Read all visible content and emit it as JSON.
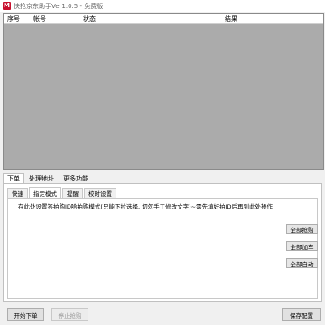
{
  "window": {
    "icon_letter": "M",
    "title": "快抢京东助手Ver1.0.5 - 免费版"
  },
  "table": {
    "columns": [
      "序号",
      "帐号",
      "状态",
      "结果"
    ]
  },
  "main_tabs": [
    {
      "label": "下单",
      "active": true
    },
    {
      "label": "处理地址",
      "active": false
    },
    {
      "label": "更多功能",
      "active": false
    }
  ],
  "sub_tabs": [
    {
      "label": "快速",
      "active": false
    },
    {
      "label": "指定模式",
      "active": true
    },
    {
      "label": "提醒",
      "active": false
    },
    {
      "label": "校时设置",
      "active": false
    }
  ],
  "panel": {
    "description": "在此处设置答拍购ID哈拍购模式(只能下拉选择, 切勿手工修改文字)~需先填好拍ID后再到此处操作",
    "buttons": {
      "buy_all": "全部抢购",
      "add_all": "全部加车",
      "auto_all": "全部自动"
    }
  },
  "footer": {
    "start": "开始下单",
    "stop": "停止抢购",
    "save": "保存配置"
  },
  "colors": {
    "icon_bg": "#c8102e",
    "grid_bg": "#ababab"
  }
}
